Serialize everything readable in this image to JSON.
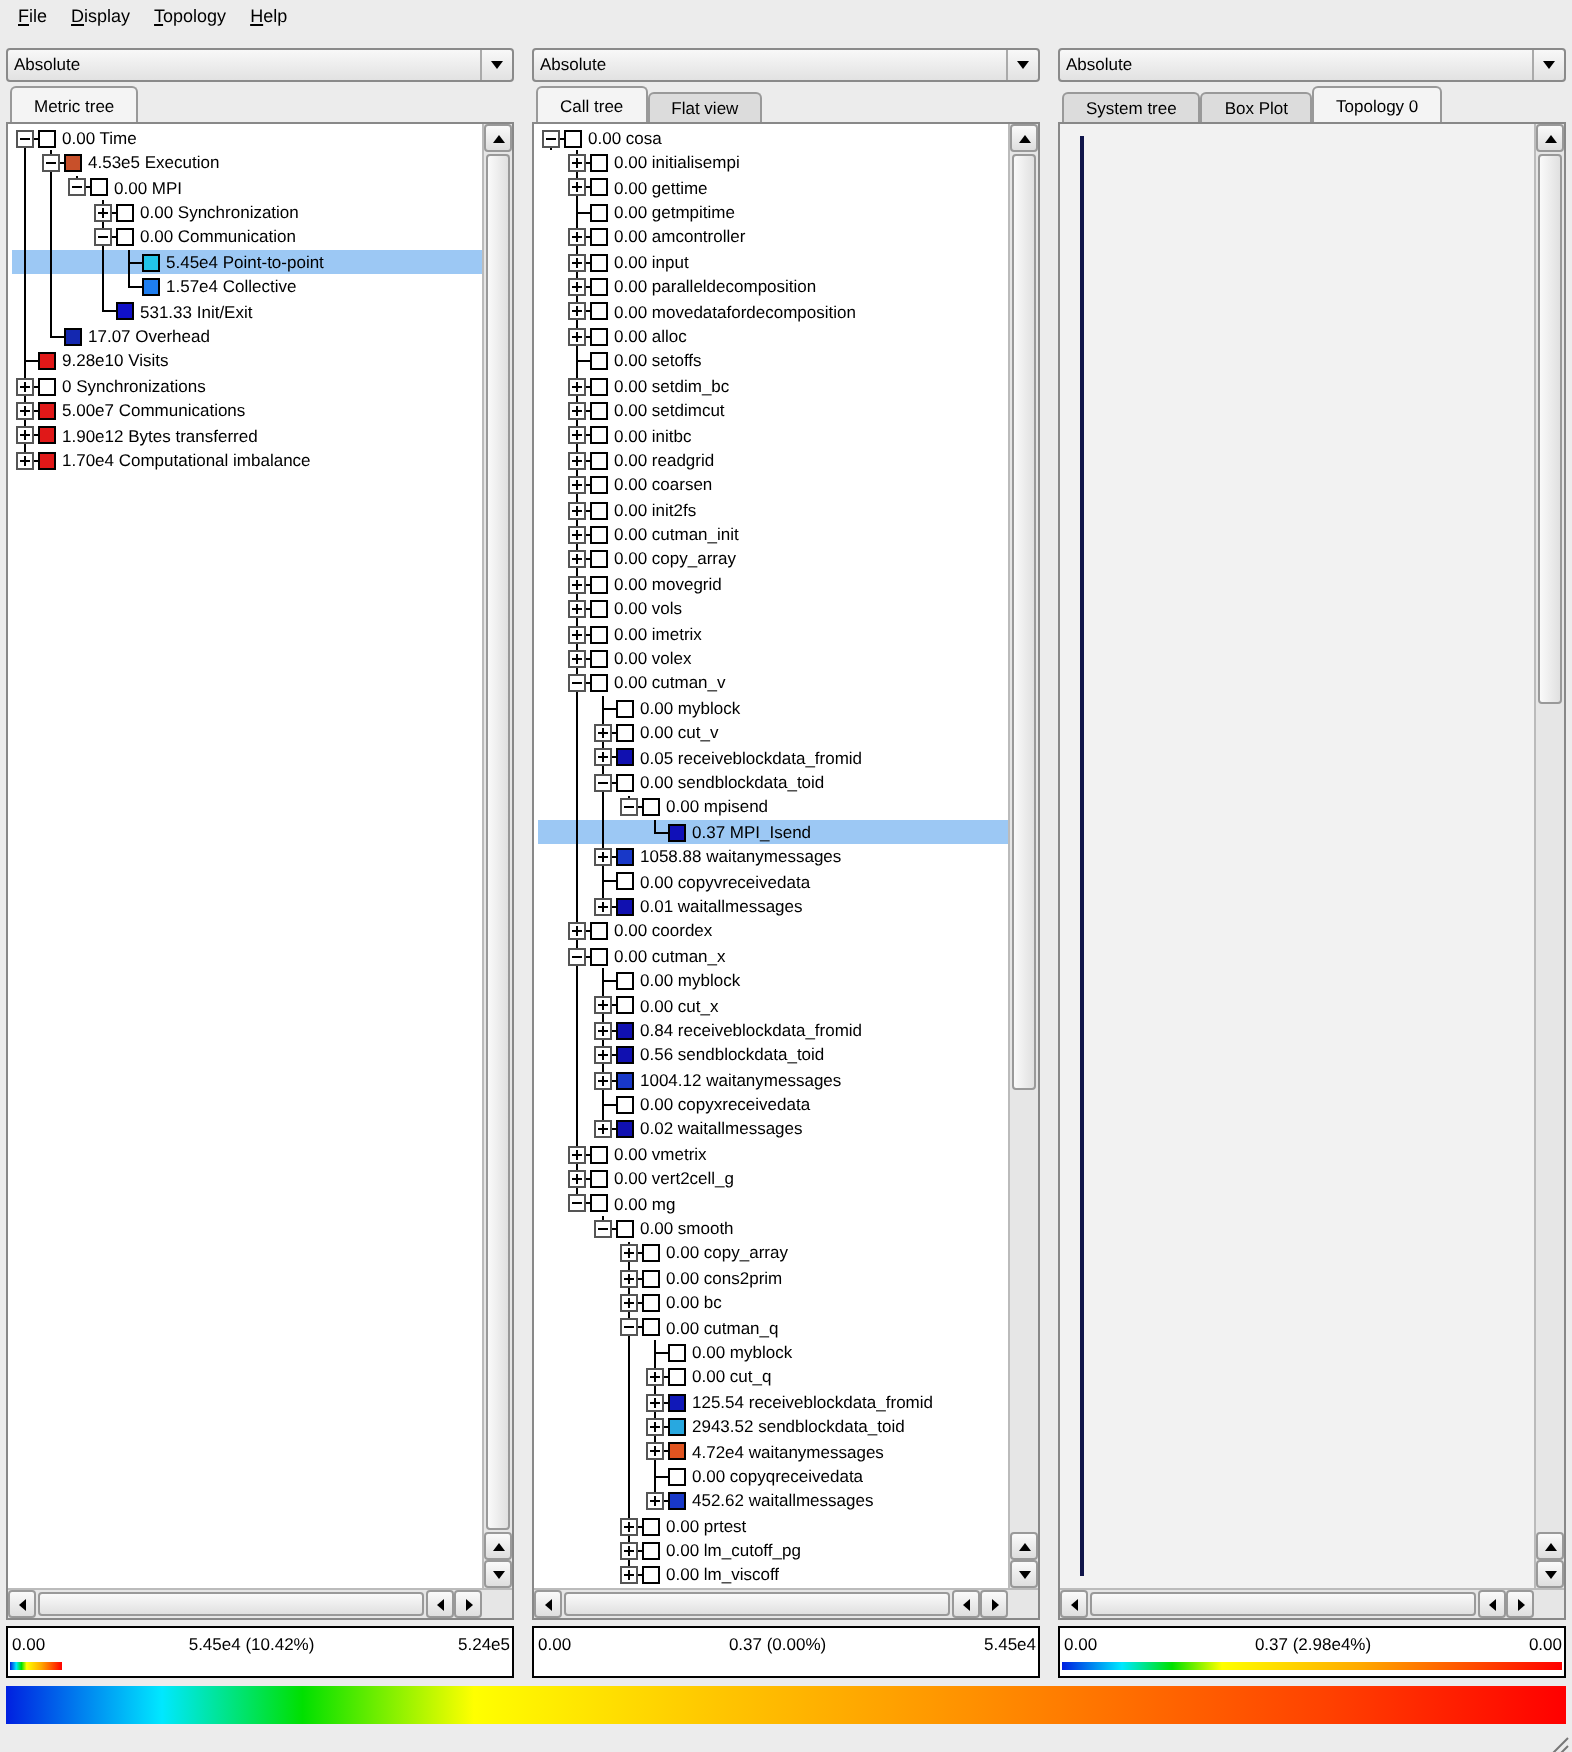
{
  "menu": [
    "File",
    "Display",
    "Topology",
    "Help"
  ],
  "panels": [
    {
      "kind": "tree",
      "mode": "Absolute",
      "tabs": [
        {
          "label": "Metric tree",
          "selected": true
        }
      ],
      "tree": [
        {
          "text": "0.00 Time",
          "color": "#ffffff",
          "expanded": true,
          "selected": false,
          "children": [
            {
              "text": "4.53e5 Execution",
              "color": "#c8502a",
              "expanded": true,
              "selected": false,
              "children": [
                {
                  "text": "0.00 MPI",
                  "color": "#ffffff",
                  "expanded": true,
                  "selected": false,
                  "children": [
                    {
                      "text": "0.00 Synchronization",
                      "color": "#ffffff",
                      "expanded": false,
                      "selected": false
                    },
                    {
                      "text": "0.00 Communication",
                      "color": "#ffffff",
                      "expanded": true,
                      "selected": false,
                      "children": [
                        {
                          "text": "5.45e4 Point-to-point",
                          "color": "#22c4e8",
                          "selected": true
                        },
                        {
                          "text": "1.57e4 Collective",
                          "color": "#1e7ef0",
                          "selected": false
                        }
                      ]
                    },
                    {
                      "text": "531.33 Init/Exit",
                      "color": "#1010c8",
                      "selected": false
                    }
                  ]
                }
              ]
            },
            {
              "text": "17.07 Overhead",
              "color": "#1428b0",
              "selected": false
            }
          ]
        },
        {
          "text": "9.28e10 Visits",
          "color": "#e01818",
          "selected": false
        },
        {
          "text": "0 Synchronizations",
          "color": "#ffffff",
          "expanded": false,
          "selected": false
        },
        {
          "text": "5.00e7 Communications",
          "color": "#e01818",
          "expanded": false,
          "selected": false
        },
        {
          "text": "1.90e12 Bytes transferred",
          "color": "#e01818",
          "expanded": false,
          "selected": false
        },
        {
          "text": "1.70e4 Computational imbalance",
          "color": "#e01818",
          "expanded": false,
          "selected": false
        }
      ],
      "scale": {
        "min": "0.00",
        "value": "5.45e4 (10.42%)",
        "max": "5.24e5",
        "level": 0.1042
      }
    },
    {
      "kind": "tree",
      "mode": "Absolute",
      "tabs": [
        {
          "label": "Call tree",
          "selected": true
        },
        {
          "label": "Flat view",
          "selected": false
        }
      ],
      "tree": [
        {
          "text": "0.00 cosa",
          "color": "#ffffff",
          "expanded": true,
          "selected": false,
          "children": [
            {
              "text": "0.00 initialisempi",
              "color": "#ffffff",
              "expanded": false,
              "selected": false
            },
            {
              "text": "0.00 gettime",
              "color": "#ffffff",
              "expanded": false,
              "selected": false
            },
            {
              "text": "0.00 getmpitime",
              "color": "#ffffff",
              "selected": false
            },
            {
              "text": "0.00 amcontroller",
              "color": "#ffffff",
              "expanded": false,
              "selected": false
            },
            {
              "text": "0.00 input",
              "color": "#ffffff",
              "expanded": false,
              "selected": false
            },
            {
              "text": "0.00 paralleldecomposition",
              "color": "#ffffff",
              "expanded": false,
              "selected": false
            },
            {
              "text": "0.00 movedatafordecomposition",
              "color": "#ffffff",
              "expanded": false,
              "selected": false
            },
            {
              "text": "0.00 alloc",
              "color": "#ffffff",
              "expanded": false,
              "selected": false
            },
            {
              "text": "0.00 setoffs",
              "color": "#ffffff",
              "selected": false
            },
            {
              "text": "0.00 setdim_bc",
              "color": "#ffffff",
              "expanded": false,
              "selected": false
            },
            {
              "text": "0.00 setdimcut",
              "color": "#ffffff",
              "expanded": false,
              "selected": false
            },
            {
              "text": "0.00 initbc",
              "color": "#ffffff",
              "expanded": false,
              "selected": false
            },
            {
              "text": "0.00 readgrid",
              "color": "#ffffff",
              "expanded": false,
              "selected": false
            },
            {
              "text": "0.00 coarsen",
              "color": "#ffffff",
              "expanded": false,
              "selected": false
            },
            {
              "text": "0.00 init2fs",
              "color": "#ffffff",
              "expanded": false,
              "selected": false
            },
            {
              "text": "0.00 cutman_init",
              "color": "#ffffff",
              "expanded": false,
              "selected": false
            },
            {
              "text": "0.00 copy_array",
              "color": "#ffffff",
              "expanded": false,
              "selected": false
            },
            {
              "text": "0.00 movegrid",
              "color": "#ffffff",
              "expanded": false,
              "selected": false
            },
            {
              "text": "0.00 vols",
              "color": "#ffffff",
              "expanded": false,
              "selected": false
            },
            {
              "text": "0.00 imetrix",
              "color": "#ffffff",
              "expanded": false,
              "selected": false
            },
            {
              "text": "0.00 volex",
              "color": "#ffffff",
              "expanded": false,
              "selected": false
            },
            {
              "text": "0.00 cutman_v",
              "color": "#ffffff",
              "expanded": true,
              "selected": false,
              "children": [
                {
                  "text": "0.00 myblock",
                  "color": "#ffffff",
                  "selected": false
                },
                {
                  "text": "0.00 cut_v",
                  "color": "#ffffff",
                  "expanded": false,
                  "selected": false
                },
                {
                  "text": "0.05 receiveblockdata_fromid",
                  "color": "#1010b0",
                  "expanded": false,
                  "selected": false
                },
                {
                  "text": "0.00 sendblockdata_toid",
                  "color": "#ffffff",
                  "expanded": true,
                  "selected": false,
                  "children": [
                    {
                      "text": "0.00 mpisend",
                      "color": "#ffffff",
                      "expanded": true,
                      "selected": false,
                      "children": [
                        {
                          "text": "0.37 MPI_Isend",
                          "color": "#1010b8",
                          "selected": true
                        }
                      ]
                    }
                  ]
                },
                {
                  "text": "1058.88 waitanymessages",
                  "color": "#1838c8",
                  "expanded": false,
                  "selected": false
                },
                {
                  "text": "0.00 copyvreceivedata",
                  "color": "#ffffff",
                  "selected": false
                },
                {
                  "text": "0.01 waitallmessages",
                  "color": "#1010b0",
                  "expanded": false,
                  "selected": false
                }
              ]
            },
            {
              "text": "0.00 coordex",
              "color": "#ffffff",
              "expanded": false,
              "selected": false
            },
            {
              "text": "0.00 cutman_x",
              "color": "#ffffff",
              "expanded": true,
              "selected": false,
              "children": [
                {
                  "text": "0.00 myblock",
                  "color": "#ffffff",
                  "selected": false
                },
                {
                  "text": "0.00 cut_x",
                  "color": "#ffffff",
                  "expanded": false,
                  "selected": false
                },
                {
                  "text": "0.84 receiveblockdata_fromid",
                  "color": "#1010b0",
                  "expanded": false,
                  "selected": false
                },
                {
                  "text": "0.56 sendblockdata_toid",
                  "color": "#1010b0",
                  "expanded": false,
                  "selected": false
                },
                {
                  "text": "1004.12 waitanymessages",
                  "color": "#1838c8",
                  "expanded": false,
                  "selected": false
                },
                {
                  "text": "0.00 copyxreceivedata",
                  "color": "#ffffff",
                  "selected": false
                },
                {
                  "text": "0.02 waitallmessages",
                  "color": "#1010b0",
                  "expanded": false,
                  "selected": false
                }
              ]
            },
            {
              "text": "0.00 vmetrix",
              "color": "#ffffff",
              "expanded": false,
              "selected": false
            },
            {
              "text": "0.00 vert2cell_g",
              "color": "#ffffff",
              "expanded": false,
              "selected": false
            },
            {
              "text": "0.00 mg",
              "color": "#ffffff",
              "expanded": true,
              "selected": false,
              "children": [
                {
                  "text": "0.00 smooth",
                  "color": "#ffffff",
                  "expanded": true,
                  "selected": false,
                  "children": [
                    {
                      "text": "0.00 copy_array",
                      "color": "#ffffff",
                      "expanded": false,
                      "selected": false
                    },
                    {
                      "text": "0.00 cons2prim",
                      "color": "#ffffff",
                      "expanded": false,
                      "selected": false
                    },
                    {
                      "text": "0.00 bc",
                      "color": "#ffffff",
                      "expanded": false,
                      "selected": false
                    },
                    {
                      "text": "0.00 cutman_q",
                      "color": "#ffffff",
                      "expanded": true,
                      "selected": false,
                      "children": [
                        {
                          "text": "0.00 myblock",
                          "color": "#ffffff",
                          "selected": false
                        },
                        {
                          "text": "0.00 cut_q",
                          "color": "#ffffff",
                          "expanded": false,
                          "selected": false
                        },
                        {
                          "text": "125.54 receiveblockdata_fromid",
                          "color": "#1018b8",
                          "expanded": false,
                          "selected": false
                        },
                        {
                          "text": "2943.52 sendblockdata_toid",
                          "color": "#28a8e0",
                          "expanded": false,
                          "selected": false
                        },
                        {
                          "text": "4.72e4 waitanymessages",
                          "color": "#e05420",
                          "expanded": false,
                          "selected": false
                        },
                        {
                          "text": "0.00 copyqreceivedata",
                          "color": "#ffffff",
                          "selected": false
                        },
                        {
                          "text": "452.62 waitallmessages",
                          "color": "#1838c8",
                          "expanded": false,
                          "selected": false
                        }
                      ]
                    },
                    {
                      "text": "0.00 prtest",
                      "color": "#ffffff",
                      "expanded": false,
                      "selected": false
                    },
                    {
                      "text": "0.00 lm_cutoff_pg",
                      "color": "#ffffff",
                      "expanded": false,
                      "selected": false
                    },
                    {
                      "text": "0.00 lm_viscoff",
                      "color": "#ffffff",
                      "expanded": false,
                      "selected": false
                    }
                  ]
                }
              ]
            }
          ]
        }
      ],
      "scale": {
        "min": "0.00",
        "value": "0.37 (0.00%)",
        "max": "5.45e4",
        "level": 0
      }
    },
    {
      "kind": "topology",
      "mode": "Absolute",
      "tabs": [
        {
          "label": "System tree",
          "selected": false
        },
        {
          "label": "Box Plot",
          "selected": false
        },
        {
          "label": "Topology 0",
          "selected": true
        }
      ],
      "scale": {
        "min": "0.00",
        "value": "0.37 (2.98e4%)",
        "max": "0.00",
        "level": 1
      }
    }
  ]
}
